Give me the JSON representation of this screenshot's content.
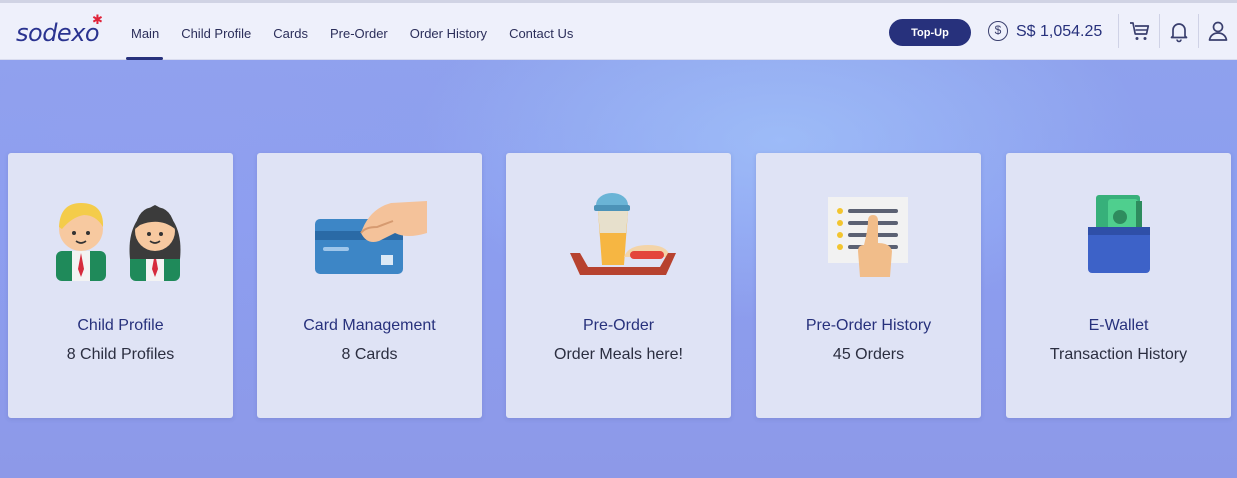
{
  "header": {
    "logo": "sodexo",
    "nav": [
      {
        "label": "Main",
        "active": true
      },
      {
        "label": "Child Profile",
        "active": false
      },
      {
        "label": "Cards",
        "active": false
      },
      {
        "label": "Pre-Order",
        "active": false
      },
      {
        "label": "Order History",
        "active": false
      },
      {
        "label": "Contact Us",
        "active": false
      }
    ],
    "topup_label": "Top-Up",
    "balance_symbol": "$",
    "balance": "S$ 1,054.25",
    "icons": [
      "cart-icon",
      "bell-icon",
      "user-icon"
    ]
  },
  "cards": [
    {
      "title": "Child Profile",
      "subtitle": "8 Child Profiles",
      "icon": "children-icon"
    },
    {
      "title": "Card Management",
      "subtitle": "8 Cards",
      "icon": "card-hand-icon"
    },
    {
      "title": "Pre-Order",
      "subtitle": "Order Meals here!",
      "icon": "meal-tray-icon"
    },
    {
      "title": "Pre-Order History",
      "subtitle": "45 Orders",
      "icon": "receipt-finger-icon"
    },
    {
      "title": "E-Wallet",
      "subtitle": "Transaction History",
      "icon": "wallet-icon"
    }
  ],
  "colors": {
    "brand_navy": "#27317c",
    "topbar_bg": "#eef0fb",
    "card_bg": "#dfe3f5",
    "logo_star": "#e0233a"
  }
}
